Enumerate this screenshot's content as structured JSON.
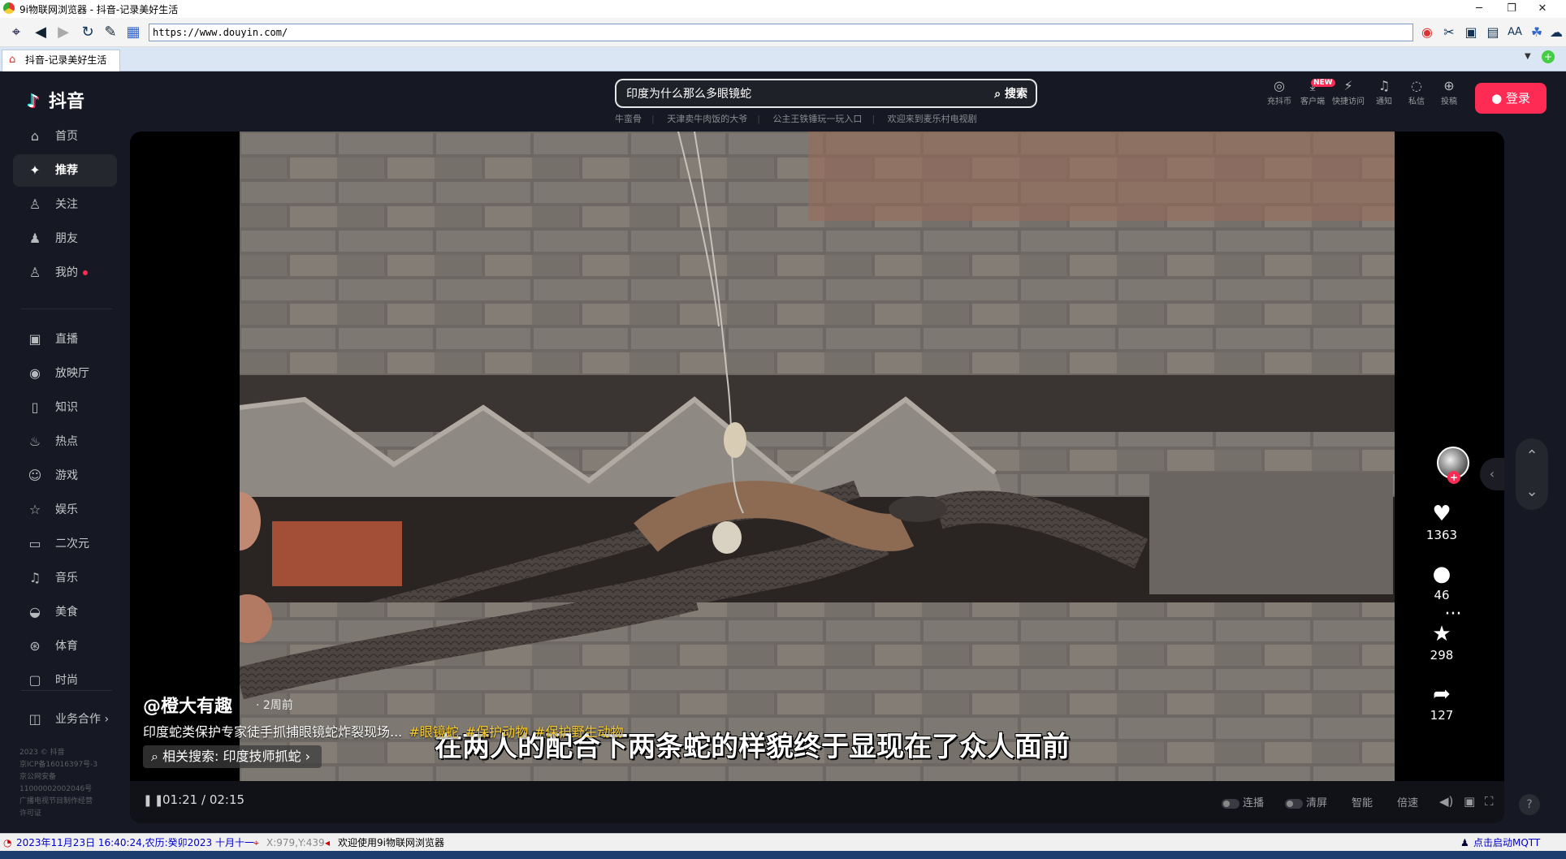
{
  "window": {
    "title": "9i物联网浏览器 - 抖音-记录美好生活",
    "controls": [
      "─",
      "❐",
      "✕"
    ]
  },
  "toolbar": {
    "url": "https://www.douyin.com/"
  },
  "tab": {
    "label": "抖音-记录美好生活"
  },
  "header": {
    "logo": "抖音",
    "search_query": "印度为什么那么多眼镜蛇",
    "search_button": "搜索",
    "hot_searches": [
      "牛蛮骨",
      "天津卖牛肉饭的大爷",
      "公主王铁锤玩一玩入口",
      "欢迎来到麦乐村电视剧"
    ],
    "top_icons": [
      {
        "label": "充抖币",
        "icon": "coin-icon",
        "glyph": "◎"
      },
      {
        "label": "客户端",
        "icon": "download-icon",
        "glyph": "⤓"
      },
      {
        "label": "快捷访问",
        "icon": "lightning-icon",
        "glyph": "⚡"
      },
      {
        "label": "通知",
        "icon": "bell-icon",
        "glyph": "🔔"
      },
      {
        "label": "私信",
        "icon": "message-icon",
        "glyph": "💬"
      },
      {
        "label": "投稿",
        "icon": "upload-icon",
        "glyph": "⊕"
      }
    ],
    "new_badge": "NEW",
    "login_button": "登录"
  },
  "sidebar": {
    "items": [
      {
        "label": "首页",
        "icon": "home-icon",
        "glyph": "⌂"
      },
      {
        "label": "推荐",
        "icon": "sparkle-icon",
        "glyph": "✦",
        "active": true
      },
      {
        "label": "关注",
        "icon": "follow-icon",
        "glyph": "♙"
      },
      {
        "label": "朋友",
        "icon": "friends-icon",
        "glyph": "♟"
      },
      {
        "label": "我的",
        "icon": "user-icon",
        "glyph": "♙"
      },
      {
        "label": "直播",
        "icon": "live-icon",
        "glyph": "▣"
      },
      {
        "label": "放映厅",
        "icon": "cinema-icon",
        "glyph": "◉"
      },
      {
        "label": "知识",
        "icon": "book-icon",
        "glyph": "▯"
      },
      {
        "label": "热点",
        "icon": "fire-icon",
        "glyph": "♨"
      },
      {
        "label": "游戏",
        "icon": "gamepad-icon",
        "glyph": "☺"
      },
      {
        "label": "娱乐",
        "icon": "star-icon",
        "glyph": "☆"
      },
      {
        "label": "二次元",
        "icon": "anime-icon",
        "glyph": "▭"
      },
      {
        "label": "音乐",
        "icon": "music-icon",
        "glyph": "♫"
      },
      {
        "label": "美食",
        "icon": "food-icon",
        "glyph": "◒"
      },
      {
        "label": "体育",
        "icon": "ball-icon",
        "glyph": "⊛"
      },
      {
        "label": "时尚",
        "icon": "bag-icon",
        "glyph": "▢"
      },
      {
        "label": "业务合作 ›",
        "icon": "business-icon",
        "glyph": "◫"
      }
    ],
    "footer": [
      "2023 © 抖音",
      "京ICP备16016397号-3",
      "京公网安备",
      "11000002002046号",
      "广播电视节目制作经营",
      "许可证"
    ]
  },
  "video": {
    "caption": "在两人的配合下两条蛇的样貌终于显现在了众人面前",
    "author": "@橙大有趣",
    "time": "· 2周前",
    "description": "印度蛇类保护专家徒手抓捕眼镜蛇炸裂现场...",
    "tags": [
      "#眼镜蛇",
      "#保护动物",
      "#保护野生动物"
    ],
    "related_search": "相关搜索: 印度技师抓蛇",
    "time_display": "01:21 / 02:15",
    "controls": [
      "连播",
      "清屏",
      "智能",
      "倍速"
    ]
  },
  "actions": {
    "likes": "1363",
    "comments": "46",
    "favorites": "298",
    "shares": "127"
  },
  "statusbar": {
    "datetime": "2023年11月23日 16:40:24,农历:癸卯2023 十月十一",
    "coords": "X:979,Y:439",
    "welcome": "欢迎使用9i物联网浏览器",
    "mqtt": "点击启动MQTT"
  },
  "colors": {
    "page_bg": "#161823",
    "accent": "#fe2c55",
    "tag": "#facd2e"
  }
}
